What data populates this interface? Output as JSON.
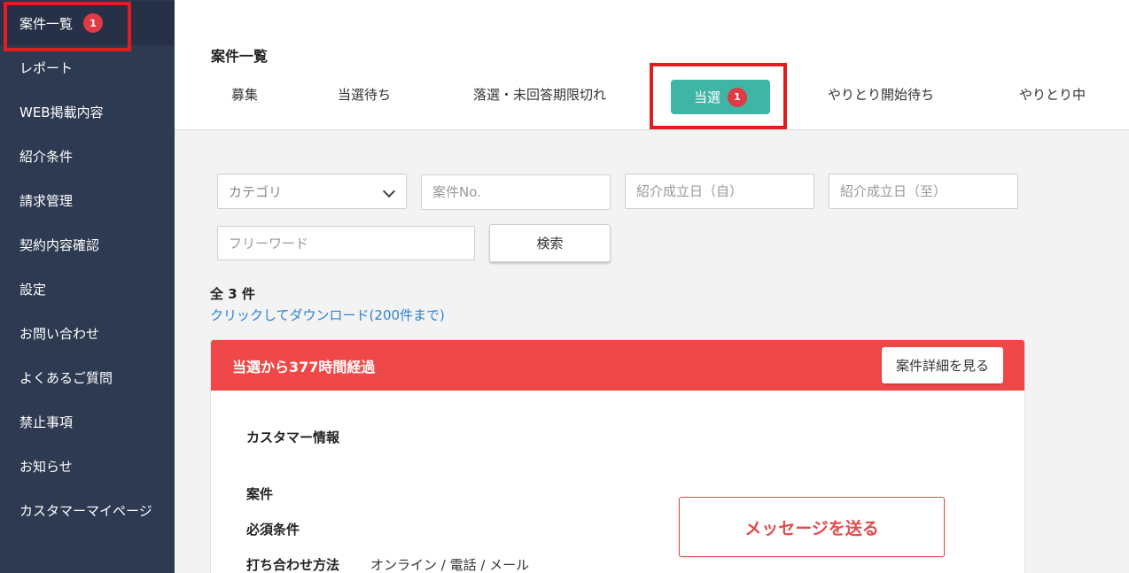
{
  "sidebar": {
    "items": [
      {
        "label": "案件一覧",
        "badge": "1"
      },
      {
        "label": "レポート"
      },
      {
        "label": "WEB掲載内容"
      },
      {
        "label": "紹介条件"
      },
      {
        "label": "請求管理"
      },
      {
        "label": "契約内容確認"
      },
      {
        "label": "設定"
      },
      {
        "label": "お問い合わせ"
      },
      {
        "label": "よくあるご質問"
      },
      {
        "label": "禁止事項"
      },
      {
        "label": "お知らせ"
      },
      {
        "label": "カスタマーマイページ"
      }
    ]
  },
  "header": {
    "title": "案件一覧",
    "tabs": [
      {
        "label": "募集"
      },
      {
        "label": "当選待ち"
      },
      {
        "label": "落選・未回答期限切れ"
      },
      {
        "label": "当選",
        "badge": "1"
      },
      {
        "label": "やりとり開始待ち"
      },
      {
        "label": "やりとり中"
      }
    ]
  },
  "filters": {
    "category_placeholder": "カテゴリ",
    "case_no_placeholder": "案件No.",
    "date_from_placeholder": "紹介成立日（自）",
    "date_to_placeholder": "紹介成立日（至）",
    "freeword_placeholder": "フリーワード",
    "search_label": "検索"
  },
  "results": {
    "total": "全 3 件",
    "download_link": "クリックしてダウンロード(200件まで)"
  },
  "card": {
    "header_title": "当選から377時間経過",
    "detail_button": "案件詳細を見る",
    "customer_info_label": "カスタマー情報",
    "case_label": "案件",
    "required_label": "必須条件",
    "meeting_label": "打ち合わせ方法",
    "meeting_value": "オンライン / 電話 / メール",
    "message_button": "メッセージを送る"
  },
  "colors": {
    "sidebar_bg": "#2e3a52",
    "accent_teal": "#3fb5a6",
    "alert_red": "#f04848",
    "badge_red": "#e03a45",
    "highlight_red": "#e01e1e",
    "link_blue": "#2b83d6"
  }
}
